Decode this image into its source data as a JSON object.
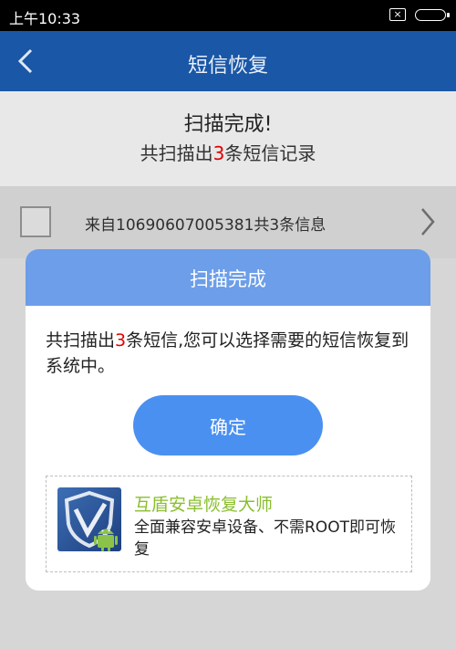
{
  "status_bar": {
    "time": "上午10:33",
    "notification_icon": "x-box-icon",
    "battery_icon": "battery-icon"
  },
  "app_bar": {
    "title": "短信恢复",
    "back_icon": "back-arrow-icon"
  },
  "summary": {
    "title": "扫描完成!",
    "sub_prefix": "共扫描出",
    "count": "3",
    "sub_suffix": "条短信记录"
  },
  "record": {
    "label": "来自10690607005381共3条信息",
    "chevron_icon": "chevron-right-icon"
  },
  "dialog": {
    "title": "扫描完成",
    "msg_prefix": "共扫描出",
    "msg_count": "3",
    "msg_suffix": "条短信,您可以选择需要的短信恢复到系统中。",
    "ok_label": "确定",
    "promo_title": "互盾安卓恢复大师",
    "promo_desc": "全面兼容安卓设备、不需ROOT即可恢复",
    "promo_logo_icon": "shield-android-logo-icon"
  },
  "colors": {
    "app_bar": "#1a57a6",
    "dialog_header": "#6c9ee9",
    "button": "#4a90f0",
    "promo_title": "#8abf2e",
    "highlight": "#e10000"
  }
}
